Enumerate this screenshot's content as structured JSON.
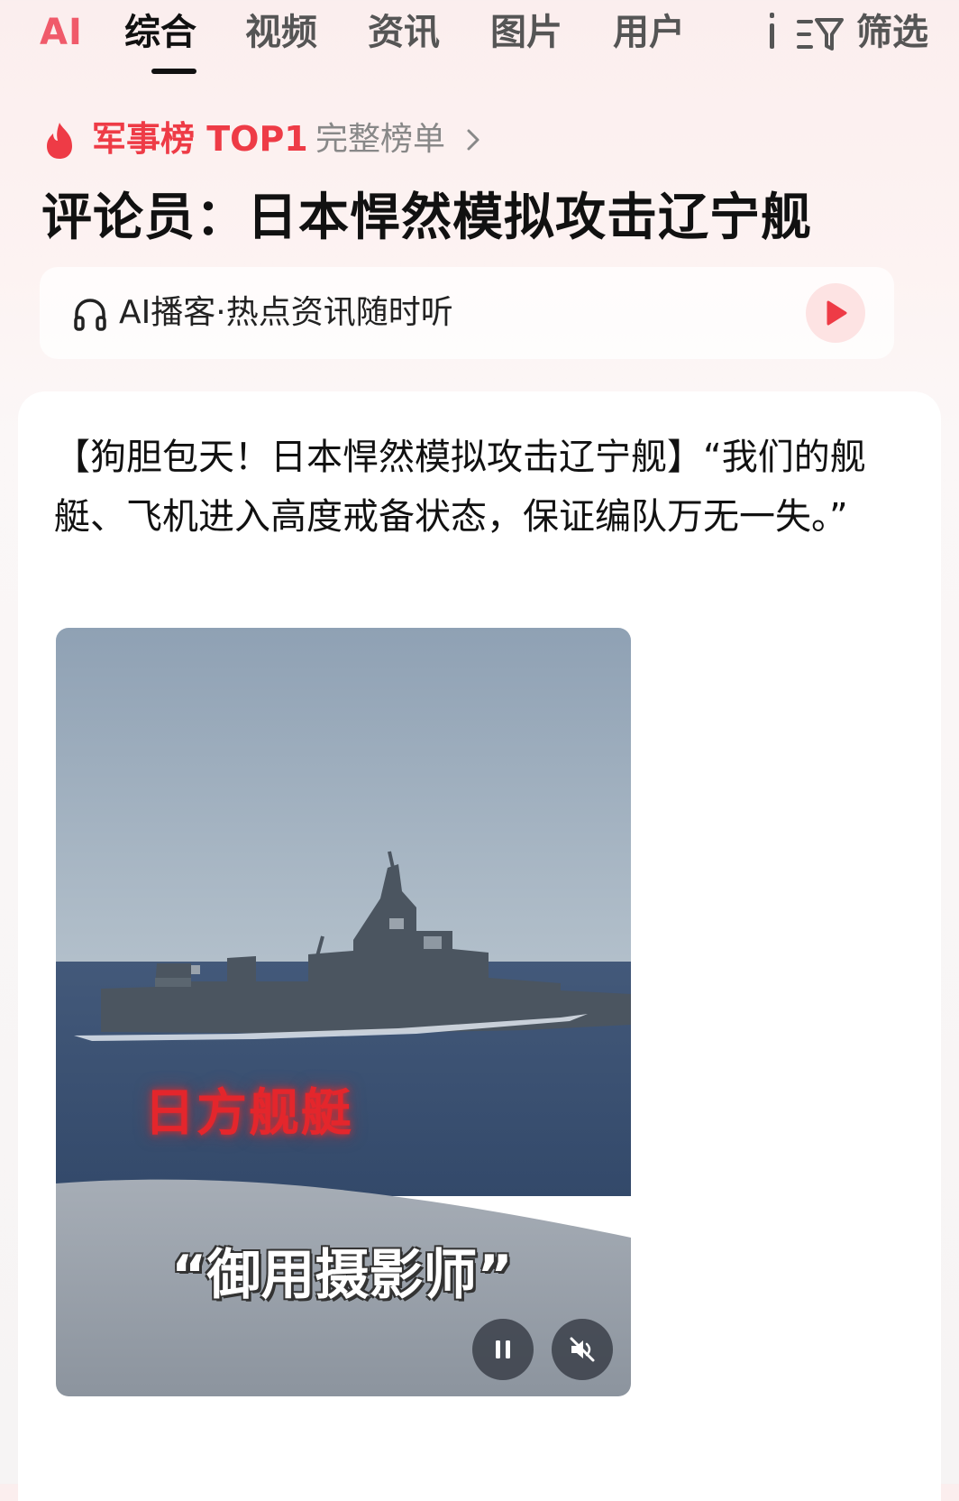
{
  "tabs": {
    "ai_label": "AI",
    "items": [
      {
        "label": "综合",
        "active": true
      },
      {
        "label": "视频",
        "active": false
      },
      {
        "label": "资讯",
        "active": false
      },
      {
        "label": "图片",
        "active": false
      },
      {
        "label": "用户",
        "active": false
      }
    ],
    "filter_label": "筛选"
  },
  "rank": {
    "title": "军事榜 TOP1",
    "link_label": "完整榜单"
  },
  "headline": "评论员：日本悍然模拟攻击辽宁舰",
  "podcast": {
    "label": "AI播客·热点资讯随时听"
  },
  "article": {
    "text": "【狗胆包天！日本悍然模拟攻击辽宁舰】“我们的舰艇、飞机进入高度戒备状态，保证编队万无一失。”"
  },
  "video": {
    "caption_red": "日方舰艇",
    "caption_white": "“御用摄影师”"
  },
  "colors": {
    "accent": "#ee3b46",
    "ai_accent": "#f05a6a",
    "sky": "#a4b3c2",
    "sea": "#3e5878"
  },
  "icons": [
    "flame-icon",
    "chevron-right-icon",
    "filter-icon",
    "more-icon",
    "headphone-icon",
    "play-icon",
    "pause-icon",
    "mute-icon"
  ]
}
